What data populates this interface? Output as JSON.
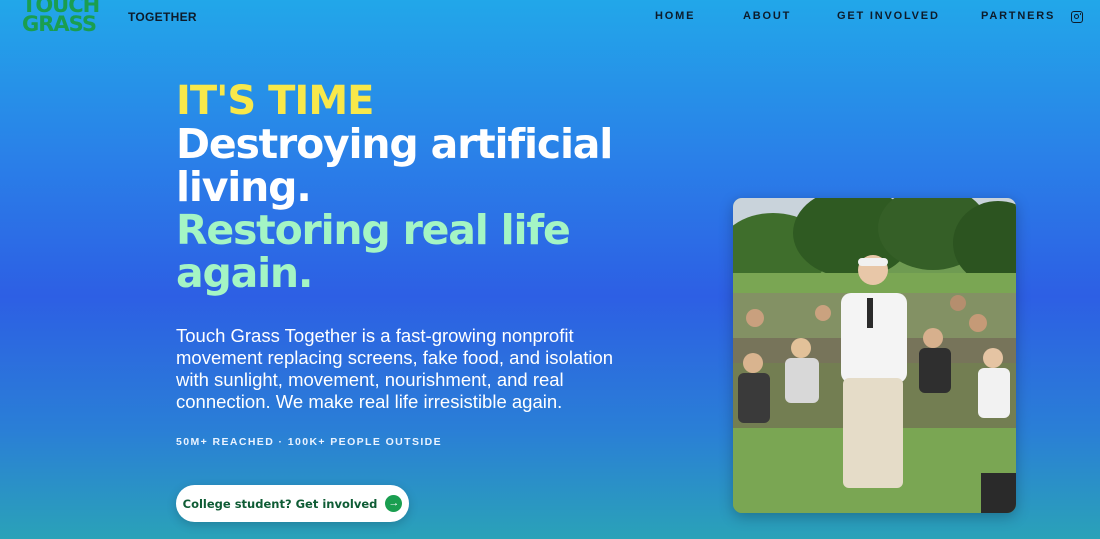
{
  "brand": {
    "logo_line1": "TOUCH",
    "logo_line2": "GRASS",
    "suffix": "TOGETHER",
    "logo_color": "#1a9e50"
  },
  "nav": {
    "items": [
      {
        "label": "HOME"
      },
      {
        "label": "ABOUT"
      },
      {
        "label": "GET INVOLVED"
      },
      {
        "label": "PARTNERS"
      }
    ],
    "social_icon": "instagram-icon"
  },
  "hero": {
    "eyebrow": "IT'S TIME",
    "headline_white": "Destroying artificial living.",
    "headline_mint": "Restoring real life again.",
    "description": "Touch Grass Together is a fast-growing nonprofit movement replacing screens, fake food, and isolation with sunlight, movement, nourishment, and real connection. We make real life irresistible again.",
    "stats": "50M+ REACHED · 100K+ PEOPLE OUTSIDE",
    "cta_label": "College student? Get involved",
    "cta_icon": "arrow-right-icon"
  },
  "colors": {
    "eyebrow": "#f8e84a",
    "mint": "#a4f5c4",
    "cta_text": "#0f5c35",
    "accent_green": "#1a9e50"
  }
}
